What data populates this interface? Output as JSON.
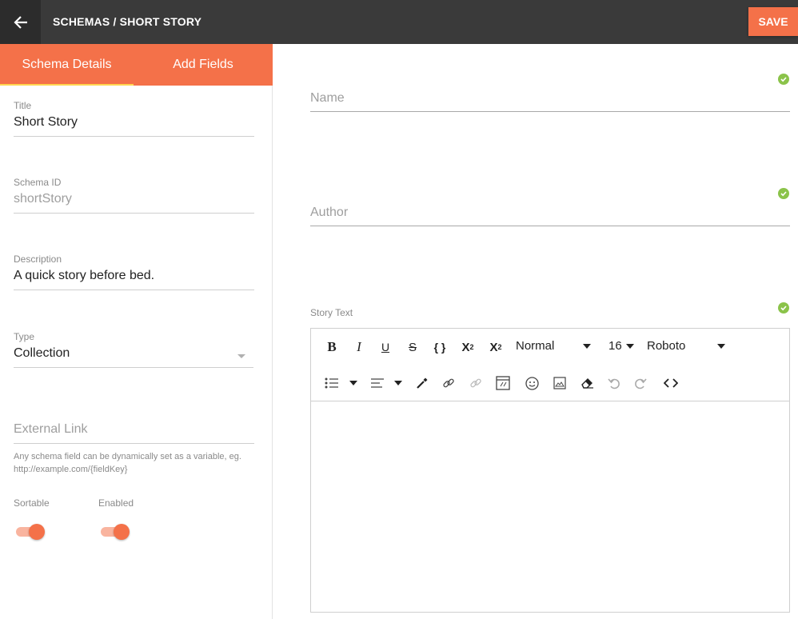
{
  "header": {
    "breadcrumb": "SCHEMAS / SHORT STORY",
    "save_label": "SAVE"
  },
  "tabs": [
    {
      "label": "Schema Details",
      "active": true
    },
    {
      "label": "Add Fields",
      "active": false
    }
  ],
  "form": {
    "title": {
      "label": "Title",
      "value": "Short Story"
    },
    "schema_id": {
      "label": "Schema ID",
      "value": "shortStory"
    },
    "description": {
      "label": "Description",
      "value": "A quick story before bed."
    },
    "type": {
      "label": "Type",
      "value": "Collection"
    },
    "external_link": {
      "placeholder": "External Link",
      "help": "Any schema field can be dynamically set as a variable, eg. http://example.com/{fieldKey}"
    },
    "sortable": {
      "label": "Sortable",
      "on": true
    },
    "enabled": {
      "label": "Enabled",
      "on": true
    }
  },
  "fields": {
    "name": {
      "placeholder": "Name"
    },
    "author": {
      "placeholder": "Author"
    },
    "story_text": {
      "label": "Story Text"
    }
  },
  "editor": {
    "block_format": "Normal",
    "font_size": "16",
    "font_family": "Roboto",
    "icons": [
      "bold-icon",
      "italic-icon",
      "underline-icon",
      "strikethrough-icon",
      "code-icon",
      "superscript-icon",
      "subscript-icon",
      "list-icon",
      "align-icon",
      "color-picker-icon",
      "link-icon",
      "unlink-icon",
      "embed-icon",
      "emoji-icon",
      "image-icon",
      "eraser-icon",
      "undo-icon",
      "redo-icon",
      "source-code-icon"
    ]
  },
  "colors": {
    "accent": "#f47149",
    "header_bg": "#3a3a3a",
    "valid": "#8bc34a"
  }
}
